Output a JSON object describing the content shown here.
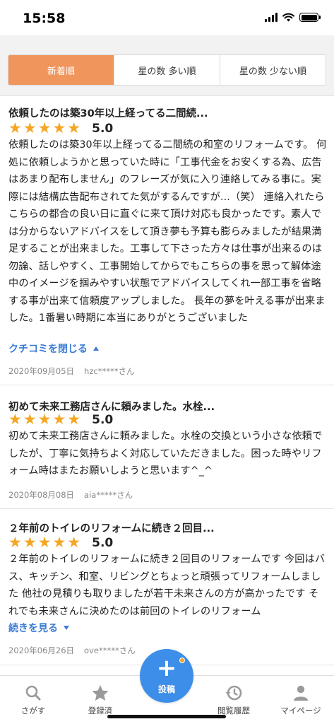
{
  "status_bar": {
    "time": "15:58"
  },
  "sort_tabs": [
    {
      "label": "新着順",
      "active": true
    },
    {
      "label": "星の数 多い順",
      "active": false
    },
    {
      "label": "星の数 少ない順",
      "active": false
    }
  ],
  "reviews": [
    {
      "title": "依頼したのは築30年以上経ってる二間続...",
      "stars": "★★★★★",
      "rating": "5.0",
      "body": "依頼したのは築30年以上経ってる二間続の和室のリフォームです。 何処に依頼しようかと思っていた時に「工事代金をお安くする為、広告はあまり配布しません」のフレーズが気に入り連絡してみる事に。実際には結構広告配布されてた気がするんですが...（笑） 連絡入れたらこちらの都合の良い日に直ぐに来て頂け対応も良かったです。素人では分からないアドバイスをして頂き夢も予算も膨らみましたが結果満足することが出来ました。工事して下さった方々は仕事が出来るのは勿論、話しやすく、工事開始してからでもこちらの事を思って解体途中のイメージを掴みやすい状態でアドバイスしてくれ一部工事を省略する事が出来て信頼度アップしました。 長年の夢を叶える事が出来ました。1番暑い時期に本当にありがとうございました",
      "toggle": "クチコミを閉じる",
      "date": "2020年09月05日",
      "user": "hzc*****さん"
    },
    {
      "title": "初めて未来工務店さんに頼みました。水栓...",
      "stars": "★★★★★",
      "rating": "5.0",
      "body": "初めて未来工務店さんに頼みました。水栓の交換という小さな依頼でしたが、丁寧に気持ちよく対応していただきました。困った時やリフォーム時はまたお願いしようと思います^_^",
      "date": "2020年08月08日",
      "user": "aia*****さん"
    },
    {
      "title": "２年前のトイレのリフォームに続き２回目...",
      "stars": "★★★★★",
      "rating": "5.0",
      "body": "２年前のトイレのリフォームに続き２回目のリフォームです 今回はバス、キッチン、和室、リビングとちょっと頑張ってリフォームしました 他社の見積りも取りましたが若干未来さんの方が高かったです それでも未来さんに決めたのは前回のトイレのリフォーム",
      "toggle": "続きを見る",
      "date": "2020年06月26日",
      "user": "ove*****さん"
    }
  ],
  "bottom_nav": {
    "search": "さがす",
    "registered": "登録済",
    "post": "投稿",
    "history": "閲覧履歴",
    "mypage": "マイページ"
  },
  "colors": {
    "accent": "#f0955c",
    "link": "#3a7bd5",
    "star": "#f5a623",
    "fab": "#3d8ee8"
  }
}
